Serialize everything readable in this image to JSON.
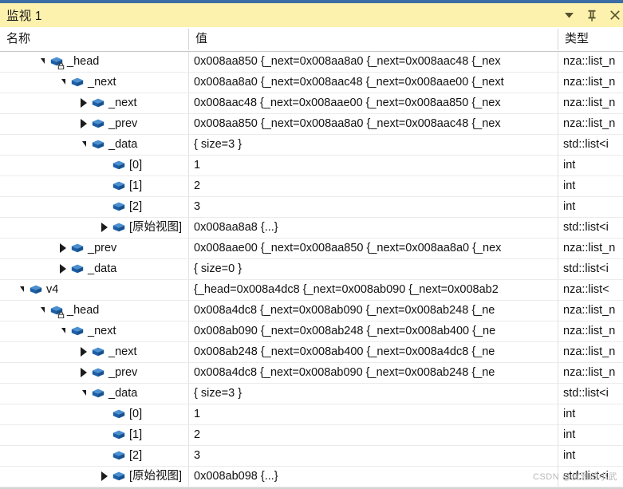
{
  "window": {
    "title": "监视 1",
    "accent_color": "#3a6ea5",
    "titlebar_color": "#fdf2ad",
    "actions": [
      {
        "name": "dropdown-button",
        "glyph": "▼"
      },
      {
        "name": "pin-button",
        "glyph": "⚲"
      },
      {
        "name": "close-button",
        "glyph": "✕"
      }
    ]
  },
  "columns": [
    {
      "key": "name",
      "label": "名称"
    },
    {
      "key": "value",
      "label": "值"
    },
    {
      "key": "type",
      "label": "类型"
    }
  ],
  "watermark": "CSDN @优雅的小武",
  "rows": [
    {
      "indent": 1,
      "expander": "open",
      "icon": "field-icon-private",
      "name": "_head",
      "value": "0x008aa850 {_next=0x008aa8a0 {_next=0x008aac48 {_nex",
      "type": "nza::list_n"
    },
    {
      "indent": 2,
      "expander": "open",
      "icon": "field-icon",
      "name": "_next",
      "value": "0x008aa8a0 {_next=0x008aac48 {_next=0x008aae00 {_next",
      "type": "nza::list_n"
    },
    {
      "indent": 3,
      "expander": "closed",
      "icon": "field-icon",
      "name": "_next",
      "value": "0x008aac48 {_next=0x008aae00 {_next=0x008aa850 {_nex",
      "type": "nza::list_n"
    },
    {
      "indent": 3,
      "expander": "closed",
      "icon": "field-icon",
      "name": "_prev",
      "value": "0x008aa850 {_next=0x008aa8a0 {_next=0x008aac48 {_nex",
      "type": "nza::list_n"
    },
    {
      "indent": 3,
      "expander": "open",
      "icon": "field-icon",
      "name": "_data",
      "value": "{ size=3 }",
      "type": "std::list<i"
    },
    {
      "indent": 4,
      "expander": "none",
      "icon": "field-icon",
      "name": "[0]",
      "value": "1",
      "type": "int"
    },
    {
      "indent": 4,
      "expander": "none",
      "icon": "field-icon",
      "name": "[1]",
      "value": "2",
      "type": "int"
    },
    {
      "indent": 4,
      "expander": "none",
      "icon": "field-icon",
      "name": "[2]",
      "value": "3",
      "type": "int"
    },
    {
      "indent": 4,
      "expander": "closed",
      "icon": "field-icon",
      "name": "[原始视图]",
      "value": "0x008aa8a8 {...}",
      "type": "std::list<i"
    },
    {
      "indent": 2,
      "expander": "closed",
      "icon": "field-icon",
      "name": "_prev",
      "value": "0x008aae00 {_next=0x008aa850 {_next=0x008aa8a0 {_nex",
      "type": "nza::list_n"
    },
    {
      "indent": 2,
      "expander": "closed",
      "icon": "field-icon",
      "name": "_data",
      "value": "{ size=0 }",
      "type": "std::list<i"
    },
    {
      "indent": 0,
      "expander": "open",
      "icon": "field-icon",
      "name": "v4",
      "value": "{_head=0x008a4dc8 {_next=0x008ab090 {_next=0x008ab2",
      "type": "nza::list<"
    },
    {
      "indent": 1,
      "expander": "open",
      "icon": "field-icon-private",
      "name": "_head",
      "value": "0x008a4dc8 {_next=0x008ab090 {_next=0x008ab248 {_ne",
      "type": "nza::list_n"
    },
    {
      "indent": 2,
      "expander": "open",
      "icon": "field-icon",
      "name": "_next",
      "value": "0x008ab090 {_next=0x008ab248 {_next=0x008ab400 {_ne",
      "type": "nza::list_n"
    },
    {
      "indent": 3,
      "expander": "closed",
      "icon": "field-icon",
      "name": "_next",
      "value": "0x008ab248 {_next=0x008ab400 {_next=0x008a4dc8 {_ne",
      "type": "nza::list_n"
    },
    {
      "indent": 3,
      "expander": "closed",
      "icon": "field-icon",
      "name": "_prev",
      "value": "0x008a4dc8 {_next=0x008ab090 {_next=0x008ab248 {_ne",
      "type": "nza::list_n"
    },
    {
      "indent": 3,
      "expander": "open",
      "icon": "field-icon",
      "name": "_data",
      "value": "{ size=3 }",
      "type": "std::list<i"
    },
    {
      "indent": 4,
      "expander": "none",
      "icon": "field-icon",
      "name": "[0]",
      "value": "1",
      "type": "int"
    },
    {
      "indent": 4,
      "expander": "none",
      "icon": "field-icon",
      "name": "[1]",
      "value": "2",
      "type": "int"
    },
    {
      "indent": 4,
      "expander": "none",
      "icon": "field-icon",
      "name": "[2]",
      "value": "3",
      "type": "int"
    },
    {
      "indent": 4,
      "expander": "closed",
      "icon": "field-icon",
      "name": "[原始视图]",
      "value": "0x008ab098 {...}",
      "type": "std::list<i"
    }
  ]
}
